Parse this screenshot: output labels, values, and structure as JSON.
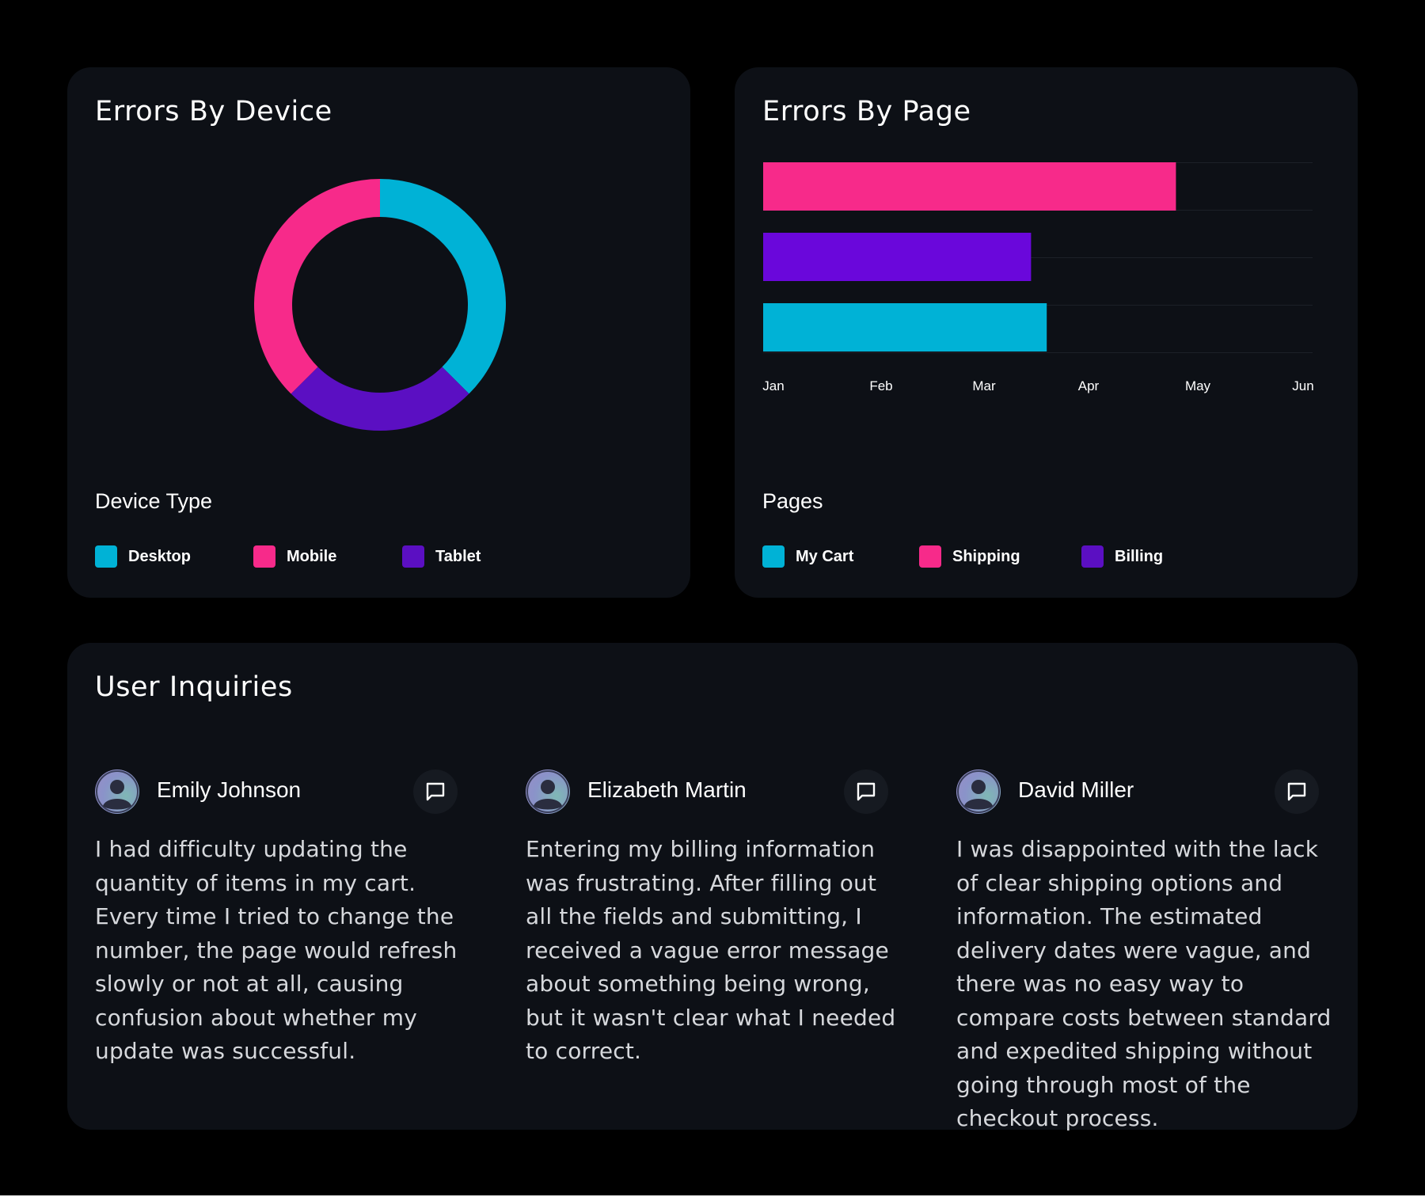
{
  "colors": {
    "cyan": "#00b2d6",
    "pink": "#f72a8a",
    "purple": "#5b0fc2",
    "violet": "#6a07db",
    "card_bg": "#0d1016"
  },
  "device_card": {
    "title": "Errors By Device",
    "legend_title": "Device Type",
    "legend": [
      {
        "label": "Desktop",
        "color": "#00b2d6"
      },
      {
        "label": "Mobile",
        "color": "#f72a8a"
      },
      {
        "label": "Tablet",
        "color": "#5b0fc2"
      }
    ]
  },
  "page_card": {
    "title": "Errors By Page",
    "legend_title": "Pages",
    "legend": [
      {
        "label": "My Cart",
        "color": "#00b2d6"
      },
      {
        "label": "Shipping",
        "color": "#f72a8a"
      },
      {
        "label": "Billing",
        "color": "#5b0fc2"
      }
    ]
  },
  "inquiries": {
    "title": "User Inquiries",
    "items": [
      {
        "name": "Emily Johnson",
        "text": "I had difficulty updating the quantity of items in my cart. Every time I tried to change the number, the page would refresh slowly or not at all, causing confusion about whether my update was successful.",
        "icon": "chat-icon"
      },
      {
        "name": "Elizabeth Martin",
        "text": "Entering my billing information was frustrating. After filling out all the fields and submitting, I received a vague error message about something being wrong, but it wasn't clear what I needed to correct.",
        "icon": "chat-icon"
      },
      {
        "name": "David Miller",
        "text": "I was disappointed with the lack of clear shipping options and information. The estimated delivery dates were vague, and there was no easy way to compare costs between standard and expedited shipping without going through most of the checkout process.",
        "icon": "chat-icon"
      }
    ]
  },
  "chart_data": [
    {
      "type": "pie",
      "title": "Errors By Device",
      "legend_title": "Device Type",
      "legend_placement": "bottom",
      "donut": true,
      "slices": [
        {
          "label": "Desktop",
          "value": 37.5,
          "color": "#00b2d6"
        },
        {
          "label": "Tablet",
          "value": 25,
          "color": "#5b0fc2"
        },
        {
          "label": "Mobile",
          "value": 37.5,
          "color": "#f72a8a"
        }
      ]
    },
    {
      "type": "bar",
      "orientation": "horizontal",
      "title": "Errors By Page",
      "legend_title": "Pages",
      "legend_placement": "bottom",
      "x_ticks": [
        "Jan",
        "Feb",
        "Mar",
        "Apr",
        "May",
        "Jun"
      ],
      "xlim": [
        "Jan",
        "Jun"
      ],
      "grid": true,
      "bars": [
        {
          "label": "Shipping",
          "value": 3.8,
          "color": "#f72a8a"
        },
        {
          "label": "Billing",
          "value": 2.45,
          "color": "#6a07db"
        },
        {
          "label": "My Cart",
          "value": 2.6,
          "color": "#00b2d6"
        }
      ]
    }
  ]
}
